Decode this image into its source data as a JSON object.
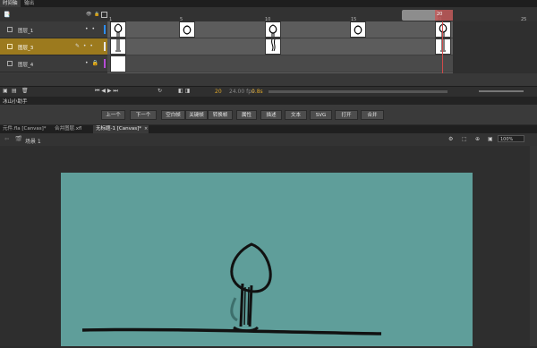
{
  "timeline_tabs": [
    {
      "label": "时间轴",
      "active": true
    },
    {
      "label": "输出",
      "active": false
    }
  ],
  "timeline": {
    "frame_numbers": [
      "1",
      "5",
      "10",
      "15",
      "20",
      "25"
    ],
    "layers": [
      {
        "name": "图层_1",
        "color": "#2c8df0",
        "selected": false
      },
      {
        "name": "图层_3",
        "color": "#e8e8e8",
        "selected": true
      },
      {
        "name": "图层_4",
        "color": "#b54bd6",
        "selected": false
      }
    ],
    "current_frame": "20",
    "fps": "24.00 fps",
    "time": "0.8s"
  },
  "panel": {
    "title": "冰山小助手",
    "buttons": [
      "上一个",
      "下一个",
      "空白帧",
      "关键帧",
      "转换帧",
      "属性",
      "描述",
      "文本",
      "SVG",
      "打开",
      "合并"
    ]
  },
  "doc_tabs": [
    {
      "label": "元件.fla [Canvas]*",
      "active": false
    },
    {
      "label": "合并图层.xfl",
      "active": false
    },
    {
      "label": "无标题-1 [Canvas]*",
      "active": true
    }
  ],
  "edit_bar": {
    "scene": "场景 1",
    "zoom": "100%"
  },
  "colors": {
    "stage": "#5f9e9a",
    "selected_layer": "#9c7a1e",
    "playhead": "#3b82c4",
    "range_end": "#c25b5b"
  }
}
